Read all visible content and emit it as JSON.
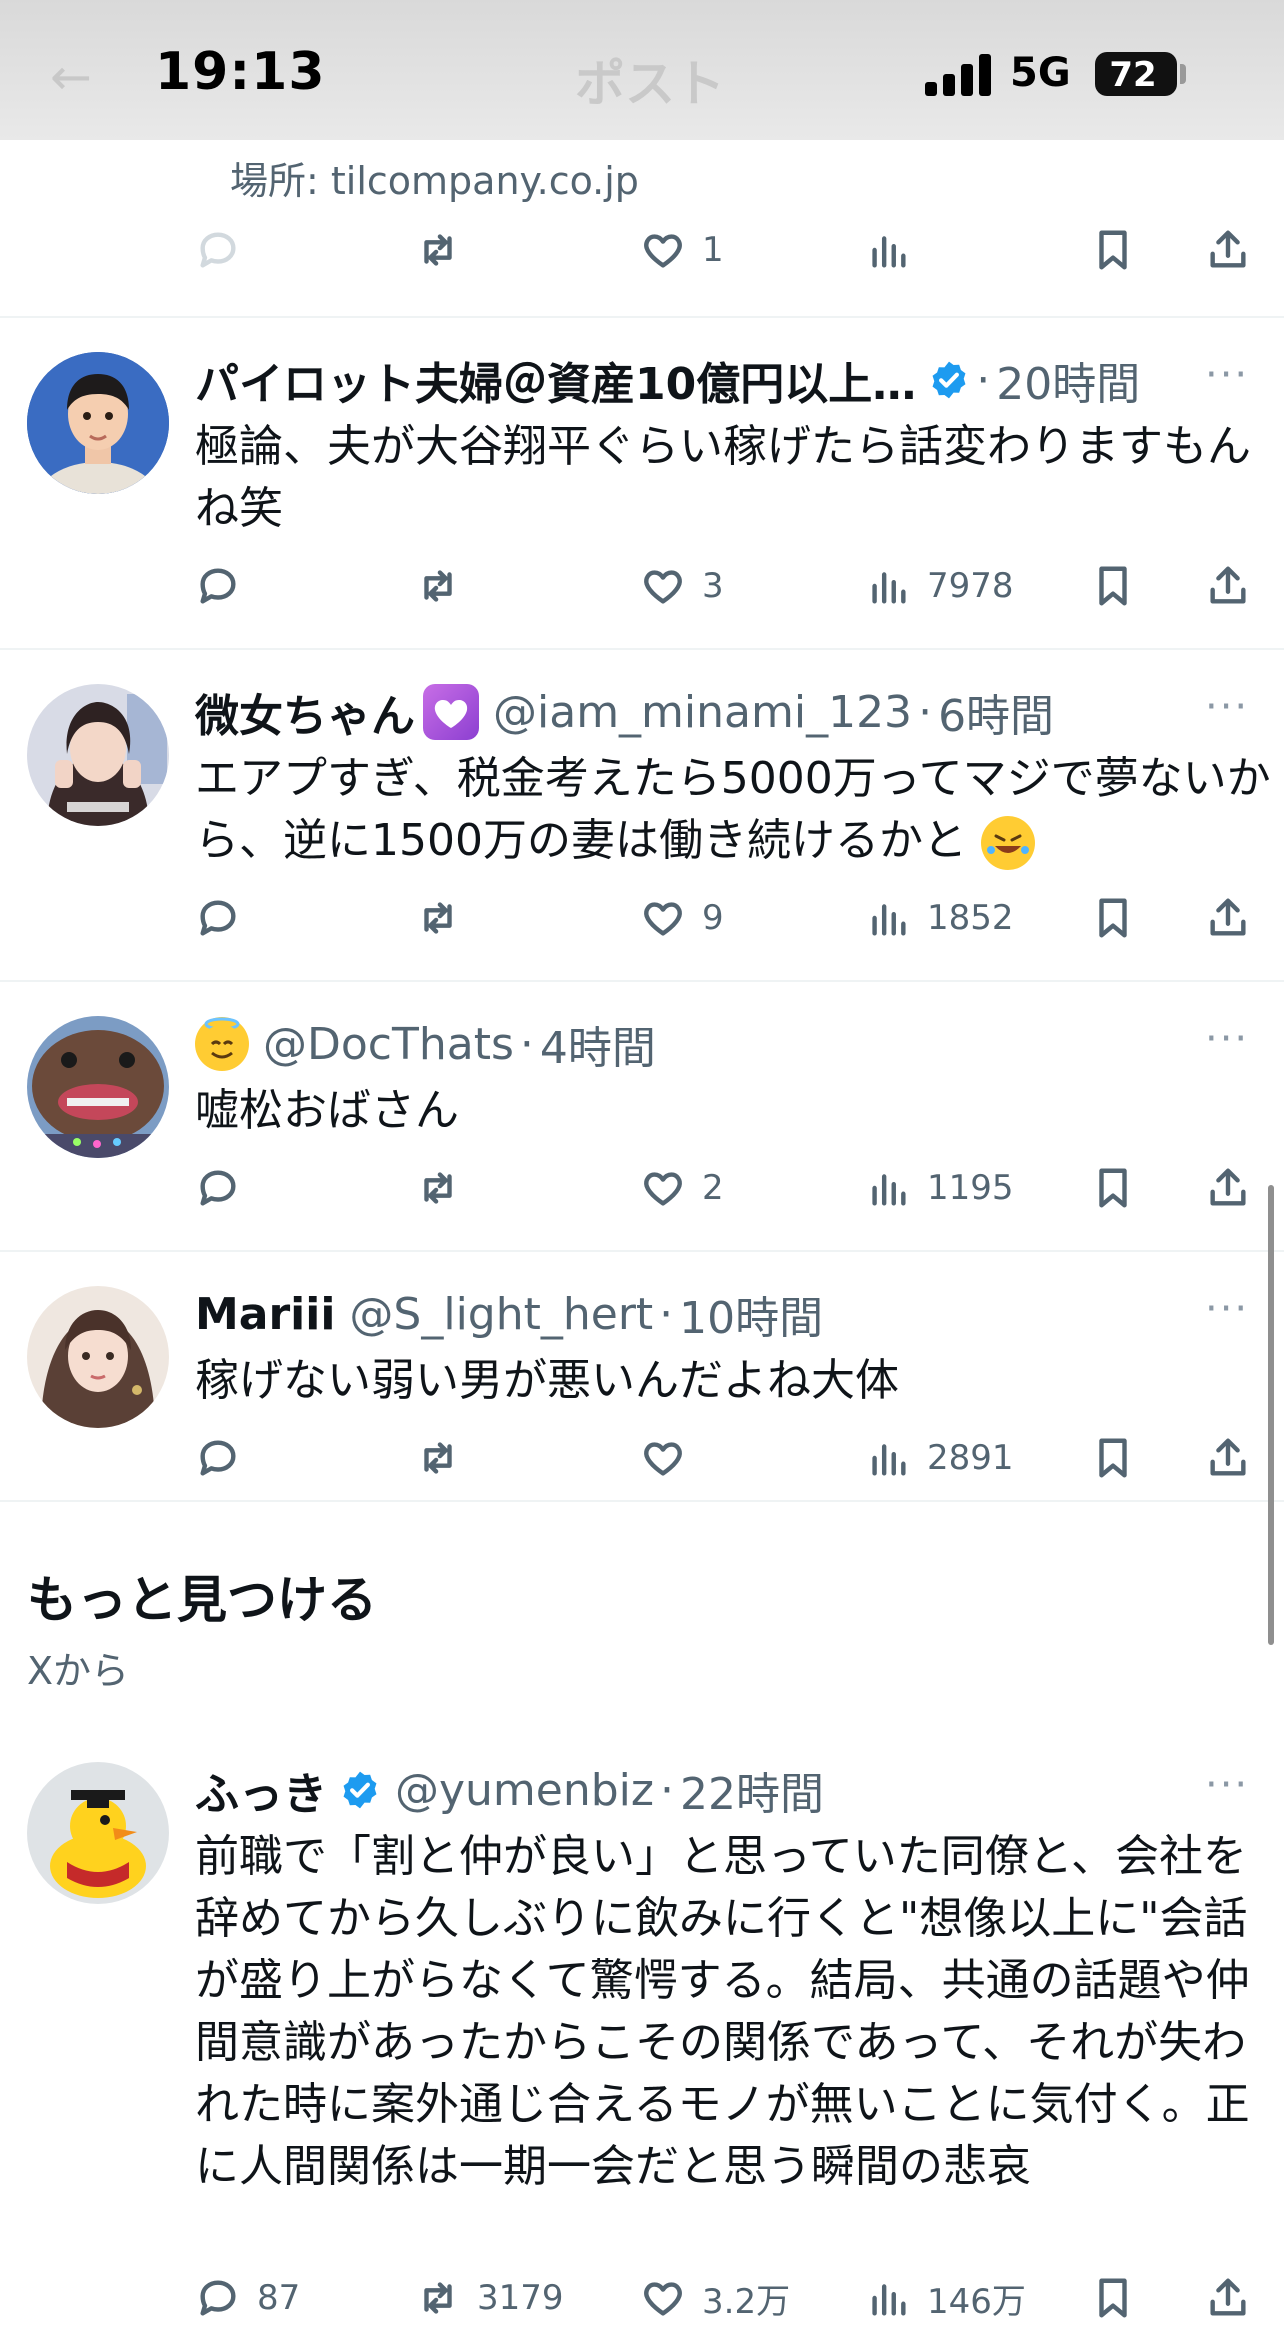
{
  "status_bar": {
    "time": "19:13",
    "ghost_title": "ポスト",
    "network": "5G",
    "battery": "72"
  },
  "prev_post": {
    "location": "場所: tilcompany.co.jp",
    "likes": "1"
  },
  "tweets": [
    {
      "name": "パイロット夫婦＠資産10億円以上…",
      "handle": "",
      "verified": true,
      "age": "20時間",
      "body": "極論、夫が大谷翔平ぐらい稼げたら話変わりますもんね笑",
      "replies": "",
      "retweets": "",
      "likes": "3",
      "views": "7978"
    },
    {
      "name": "微女ちゃん",
      "handle": "@iam_minami_123",
      "verified": false,
      "age": "6時間",
      "body": "エアプすぎ、税金考えたら5000万ってマジで夢ないから、逆に1500万の妻は働き続けるかと",
      "replies": "",
      "retweets": "",
      "likes": "9",
      "views": "1852"
    },
    {
      "name": "",
      "handle": "@DocThats",
      "verified": false,
      "age": "4時間",
      "body": "嘘松おばさん",
      "replies": "",
      "retweets": "",
      "likes": "2",
      "views": "1195"
    },
    {
      "name": "Mariii",
      "handle": "@S_light_hert",
      "verified": false,
      "age": "10時間",
      "body": "稼げない弱い男が悪いんだよね大体",
      "replies": "",
      "retweets": "",
      "likes": "",
      "views": "2891"
    }
  ],
  "discover": {
    "title": "もっと見つける",
    "subtitle": "Xから"
  },
  "featured": {
    "name": "ふっき",
    "handle": "@yumenbiz",
    "verified": true,
    "age": "22時間",
    "body": "前職で「割と仲が良い」と思っていた同僚と、会社を辞めてから久しぶりに飲みに行くと\"想像以上に\"会話が盛り上がらなくて驚愕する。結局、共通の話題や仲間意識があったからこその関係であって、それが失われた時に案外通じ合えるモノが無いことに気付く。正に人間関係は一期一会だと思う瞬間の悲哀",
    "replies": "87",
    "retweets": "3179",
    "likes": "3.2万",
    "views": "146万"
  },
  "common": {
    "dot": "·",
    "more": "···"
  },
  "colors": {
    "text": "#0f1419",
    "secondary": "#536471",
    "verified": "#1d9bf0",
    "divider": "#eff3f4"
  }
}
